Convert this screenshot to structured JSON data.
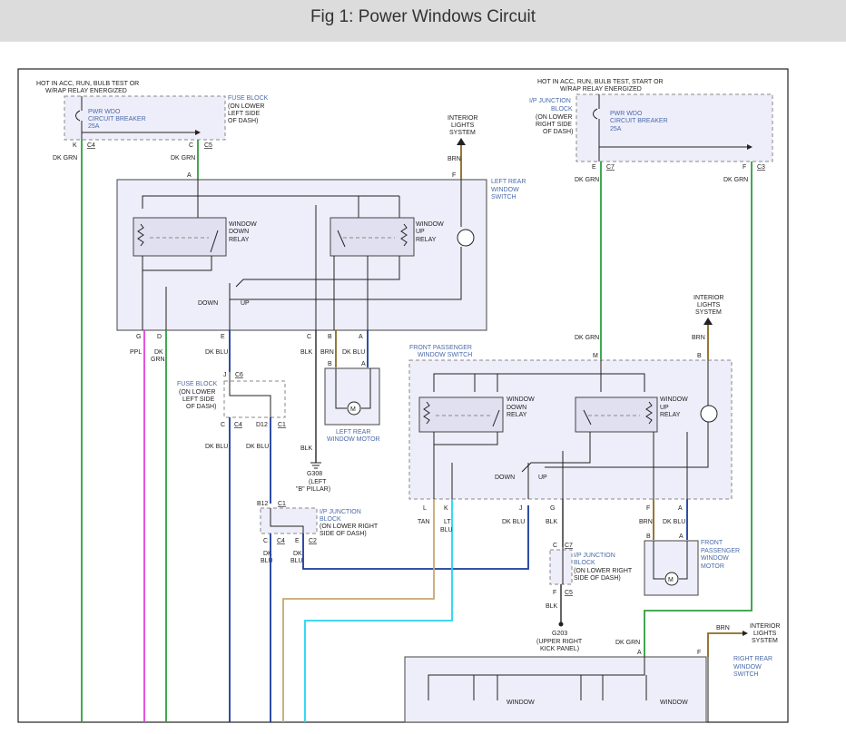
{
  "title": "Fig 1: Power Windows Circuit",
  "labels": {
    "hot_left_1": "HOT IN ACC, RUN, BULB TEST OR",
    "hot_left_2": "W/RAP RELAY ENERGIZED",
    "cb_left_1": "PWR WDO",
    "cb_left_2": "CIRCUIT BREAKER",
    "cb_left_3": "25A",
    "fuse_block_1": "FUSE BLOCK",
    "fuse_block_2": "(ON LOWER",
    "fuse_block_3": "LEFT SIDE",
    "fuse_block_4": "OF DASH)",
    "k": "K",
    "c4": "C4",
    "c": "C",
    "c5": "C5",
    "dk_grn": "DK GRN",
    "interior_1": "INTERIOR",
    "interior_2": "LIGHTS",
    "interior_3": "SYSTEM",
    "brn": "BRN",
    "a": "A",
    "f": "F",
    "lr_switch_1": "LEFT REAR",
    "lr_switch_2": "WINDOW",
    "lr_switch_3": "SWITCH",
    "window": "WINDOW",
    "down": "DOWN",
    "relay": "RELAY",
    "up": "UP",
    "g": "G",
    "d": "D",
    "e": "E",
    "b": "B",
    "ppl": "PPL",
    "dk": "DK",
    "grn": "GRN",
    "dk_blu": "DK BLU",
    "blk": "BLK",
    "j": "J",
    "c6": "C6",
    "fb2_1": "FUSE BLOCK",
    "fb2_2": "(ON LOWER",
    "fb2_3": "LEFT SIDE",
    "fb2_4": "OF DASH)",
    "d12": "D12",
    "c1": "C1",
    "lr_motor_1": "LEFT REAR",
    "lr_motor_2": "WINDOW MOTOR",
    "m": "M",
    "g308_1": "G308",
    "g308_2": "(LEFT",
    "g308_3": "\"B\" PILLAR)",
    "b12": "B12",
    "ipjb_1": "I/P JUNCTION",
    "ipjb_2": "BLOCK",
    "ipjb_3": "(ON LOWER RIGHT",
    "ipjb_4": "SIDE OF DASH)",
    "c2": "C2",
    "blu": "BLU",
    "hot_right_1": "HOT IN ACC, RUN, BULB TEST, START OR",
    "hot_right_2": "W/RAP RELAY ENERGIZED",
    "ipjb_r_1": "I/P JUNCTION",
    "ipjb_r_2": "BLOCK",
    "ipjb_r_3": "(ON LOWER",
    "ipjb_r_4": "RIGHT SIDE",
    "ipjb_r_5": "OF DASH)",
    "c7": "C7",
    "c3": "C3",
    "fp_switch_1": "FRONT PASSENGER",
    "fp_switch_2": "WINDOW SWITCH",
    "l": "L",
    "tan": "TAN",
    "lt": "LT",
    "ipjb3_1": "I/P JUNCTION",
    "ipjb3_2": "BLOCK",
    "ipjb3_3": "(ON LOWER RIGHT",
    "ipjb3_4": "SIDE OF DASH)",
    "g203_1": "G203",
    "g203_2": "(UPPER RIGHT",
    "g203_3": "KICK PANEL)",
    "fp_motor_1": "FRONT",
    "fp_motor_2": "PASSENGER",
    "fp_motor_3": "WINDOW",
    "fp_motor_4": "MOTOR",
    "rr_switch_1": "RIGHT REAR",
    "rr_switch_2": "WINDOW",
    "rr_switch_3": "SWITCH"
  },
  "colors": {
    "wire_dk_grn": "#2e9e3e",
    "wire_ppl": "#e040e0",
    "wire_dk_blu": "#1a3a9a",
    "wire_brn": "#8a6a20",
    "wire_tan": "#c8a870",
    "wire_lt_blu": "#22d4f0",
    "wire_blk": "#333333",
    "label_blue": "#4a6aa8",
    "box_fill": "#eeeefa"
  }
}
